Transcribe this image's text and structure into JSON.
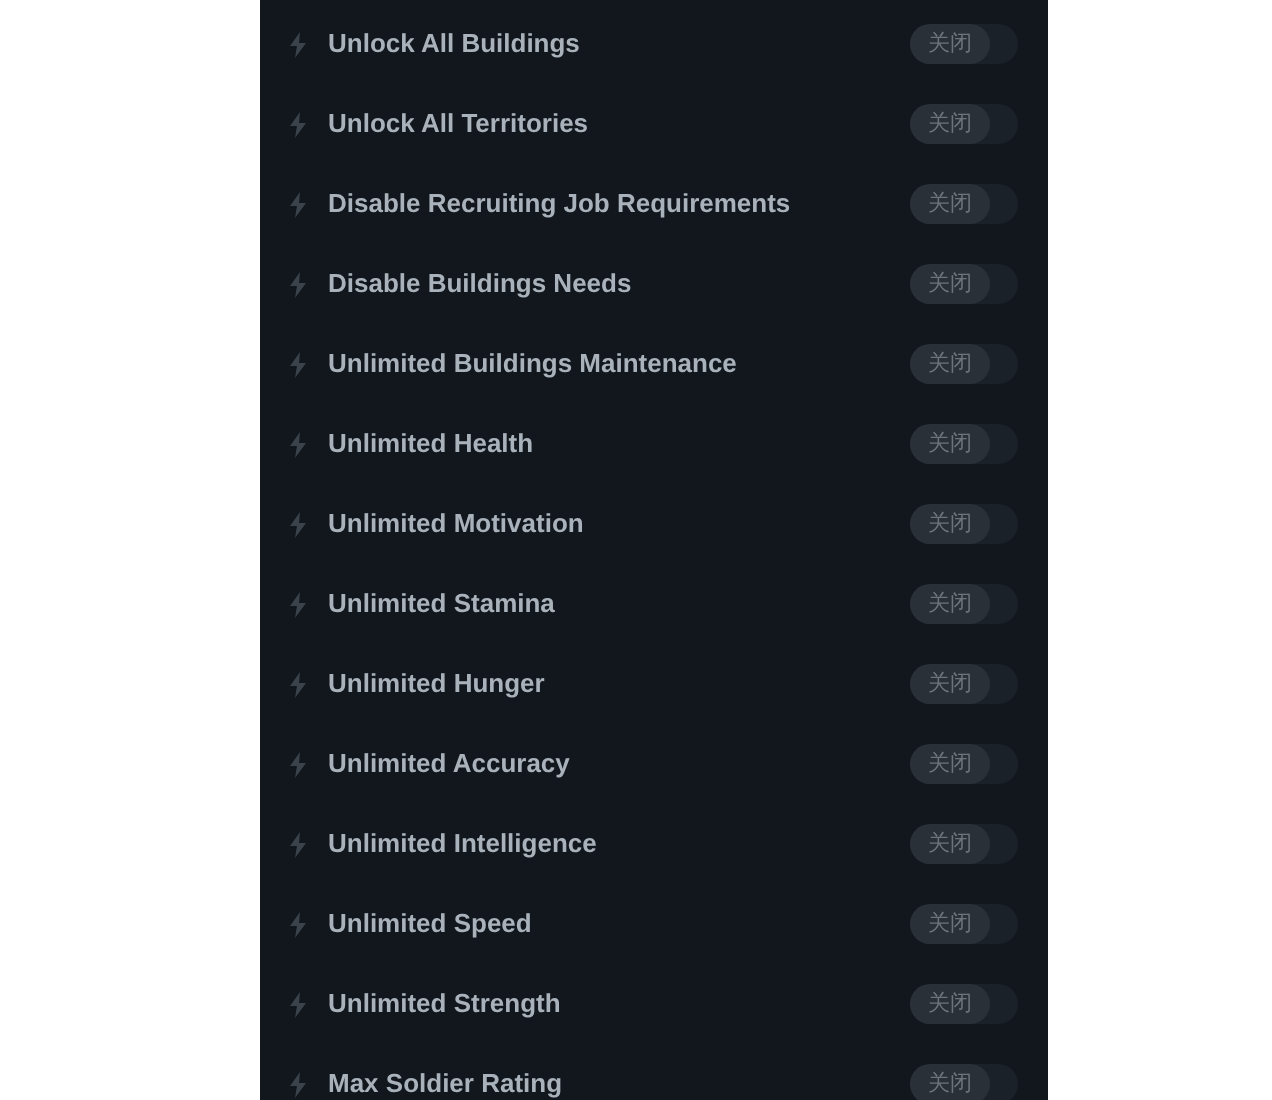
{
  "options": [
    {
      "label": "Unlock All Buildings",
      "toggle": {
        "text": "关闭",
        "on": false
      }
    },
    {
      "label": "Unlock All Territories",
      "toggle": {
        "text": "关闭",
        "on": false
      }
    },
    {
      "label": "Disable Recruiting Job Requirements",
      "toggle": {
        "text": "关闭",
        "on": false
      }
    },
    {
      "label": "Disable Buildings Needs",
      "toggle": {
        "text": "关闭",
        "on": false
      }
    },
    {
      "label": "Unlimited Buildings Maintenance",
      "toggle": {
        "text": "关闭",
        "on": false
      }
    },
    {
      "label": "Unlimited Health",
      "toggle": {
        "text": "关闭",
        "on": false
      }
    },
    {
      "label": "Unlimited Motivation",
      "toggle": {
        "text": "关闭",
        "on": false
      }
    },
    {
      "label": "Unlimited Stamina",
      "toggle": {
        "text": "关闭",
        "on": false
      }
    },
    {
      "label": "Unlimited Hunger",
      "toggle": {
        "text": "关闭",
        "on": false
      }
    },
    {
      "label": "Unlimited Accuracy",
      "toggle": {
        "text": "关闭",
        "on": false
      }
    },
    {
      "label": "Unlimited Intelligence",
      "toggle": {
        "text": "关闭",
        "on": false
      }
    },
    {
      "label": "Unlimited Speed",
      "toggle": {
        "text": "关闭",
        "on": false
      }
    },
    {
      "label": "Unlimited Strength",
      "toggle": {
        "text": "关闭",
        "on": false
      }
    },
    {
      "label": "Max Soldier Rating",
      "toggle": {
        "text": "关闭",
        "on": false
      }
    }
  ]
}
